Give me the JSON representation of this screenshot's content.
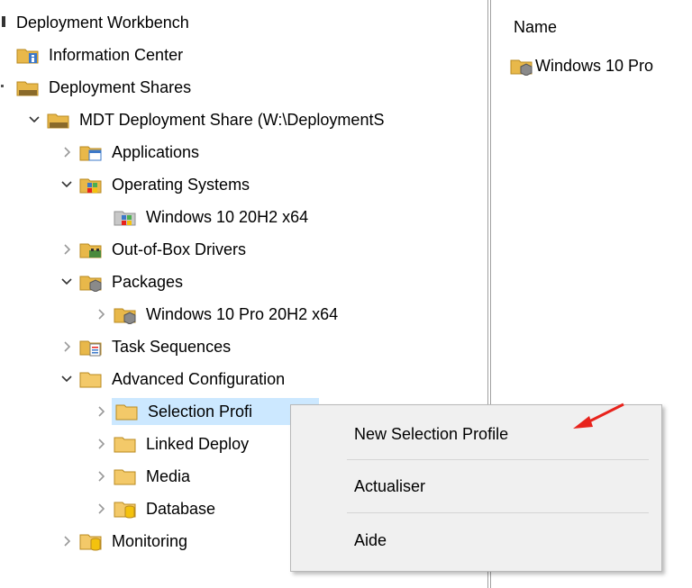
{
  "tree": {
    "root_label": "Deployment Workbench",
    "information_center": "Information Center",
    "deployment_shares": "Deployment Shares",
    "mdt_share": "MDT Deployment Share (W:\\DeploymentS",
    "applications": "Applications",
    "operating_systems": "Operating Systems",
    "os_item": "Windows 10 20H2 x64",
    "drivers": "Out-of-Box Drivers",
    "packages": "Packages",
    "package_item": "Windows 10 Pro 20H2 x64",
    "task_sequences": "Task Sequences",
    "advanced_config": "Advanced Configuration",
    "selection_profiles": "Selection Profi",
    "linked_deployment": "Linked Deploy",
    "media": "Media",
    "database": "Database",
    "monitoring": "Monitoring"
  },
  "list": {
    "column_name": "Name",
    "item": "Windows 10 Pro"
  },
  "context_menu": {
    "new_selection_profile": "New Selection Profile",
    "refresh": "Actualiser",
    "help": "Aide"
  },
  "colors": {
    "selection": "#cce8ff",
    "folder": "#e8b84a",
    "arrow": "#e8231c"
  }
}
